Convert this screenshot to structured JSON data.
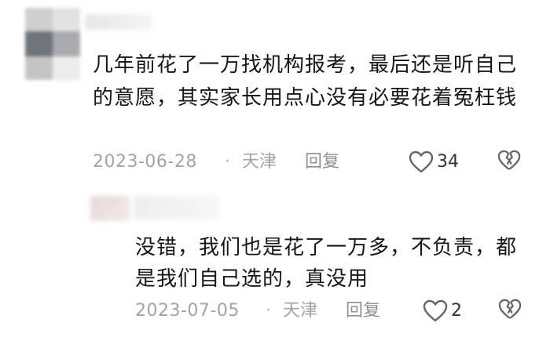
{
  "comments": [
    {
      "text": "几年前花了一万找机构报考，最后还是听自己的意愿，其实家长用点心没有必要花着冤枉钱",
      "date": "2023-06-28",
      "separator": "·",
      "location": "天津",
      "reply_label": "回复",
      "like_count": "34"
    },
    {
      "text": "没错，我们也是花了一万多，不负责，都是我们自己选的，真没用",
      "date": "2023-07-05",
      "separator": "·",
      "location": "天津",
      "reply_label": "回复",
      "like_count": "2"
    }
  ],
  "icons": {
    "like": "heart-outline-icon",
    "dislike": "broken-heart-icon"
  },
  "colors": {
    "text": "#161616",
    "meta": "#a3a3a3",
    "icon": "#666666"
  }
}
